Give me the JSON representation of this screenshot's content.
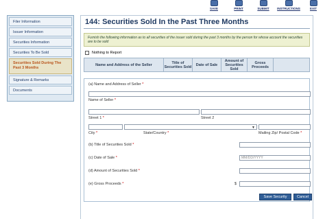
{
  "toolbar": {
    "save_label": "SAVE",
    "print_label": "PRINT",
    "submit_label": "SUBMIT",
    "instructions_label": "INSTRUCTIONS",
    "exit_label": "EXIT"
  },
  "sidebar": {
    "items": [
      {
        "label": "Filer Information"
      },
      {
        "label": "Issuer Information"
      },
      {
        "label": "Securities Information"
      },
      {
        "label": "Securities To Be Sold"
      },
      {
        "label": "Securities Sold During The Past 3 Months"
      },
      {
        "label": "Signature & Remarks"
      },
      {
        "label": "Documents"
      }
    ]
  },
  "main": {
    "title": "144: Securities Sold In the Past Three Months",
    "instructions": "Furnish the following information as to all securities of the issuer sold during the past 3 months by the person for whose account the securities are to be sold",
    "nothing_label": "Nothing to Report",
    "columns": [
      "Name and Address of the Seller",
      "Title of Securities Sold",
      "Date of Sale",
      "Amount of Securities Sold",
      "Gross Proceeds"
    ]
  },
  "form": {
    "a_label": "(a)  Name and Address of Seller",
    "name_label": "Name of Seller",
    "street1_label": "Street 1",
    "street2_label": "Street 2",
    "city_label": "City",
    "state_label": "State/Country",
    "zip_label": "Mailing Zip/ Postal Code",
    "b_label": "(b)   Title of Securities Sold",
    "c_label": "(c)   Date of Sale",
    "date_placeholder": "MM/DD/YYYY",
    "d_label": "(d)   Amount of Securities Sold",
    "e_label": "(e)   Gross Proceeds",
    "currency": "$",
    "asterisk": "*",
    "save_button": "Save Security",
    "cancel_button": "Cancel"
  }
}
